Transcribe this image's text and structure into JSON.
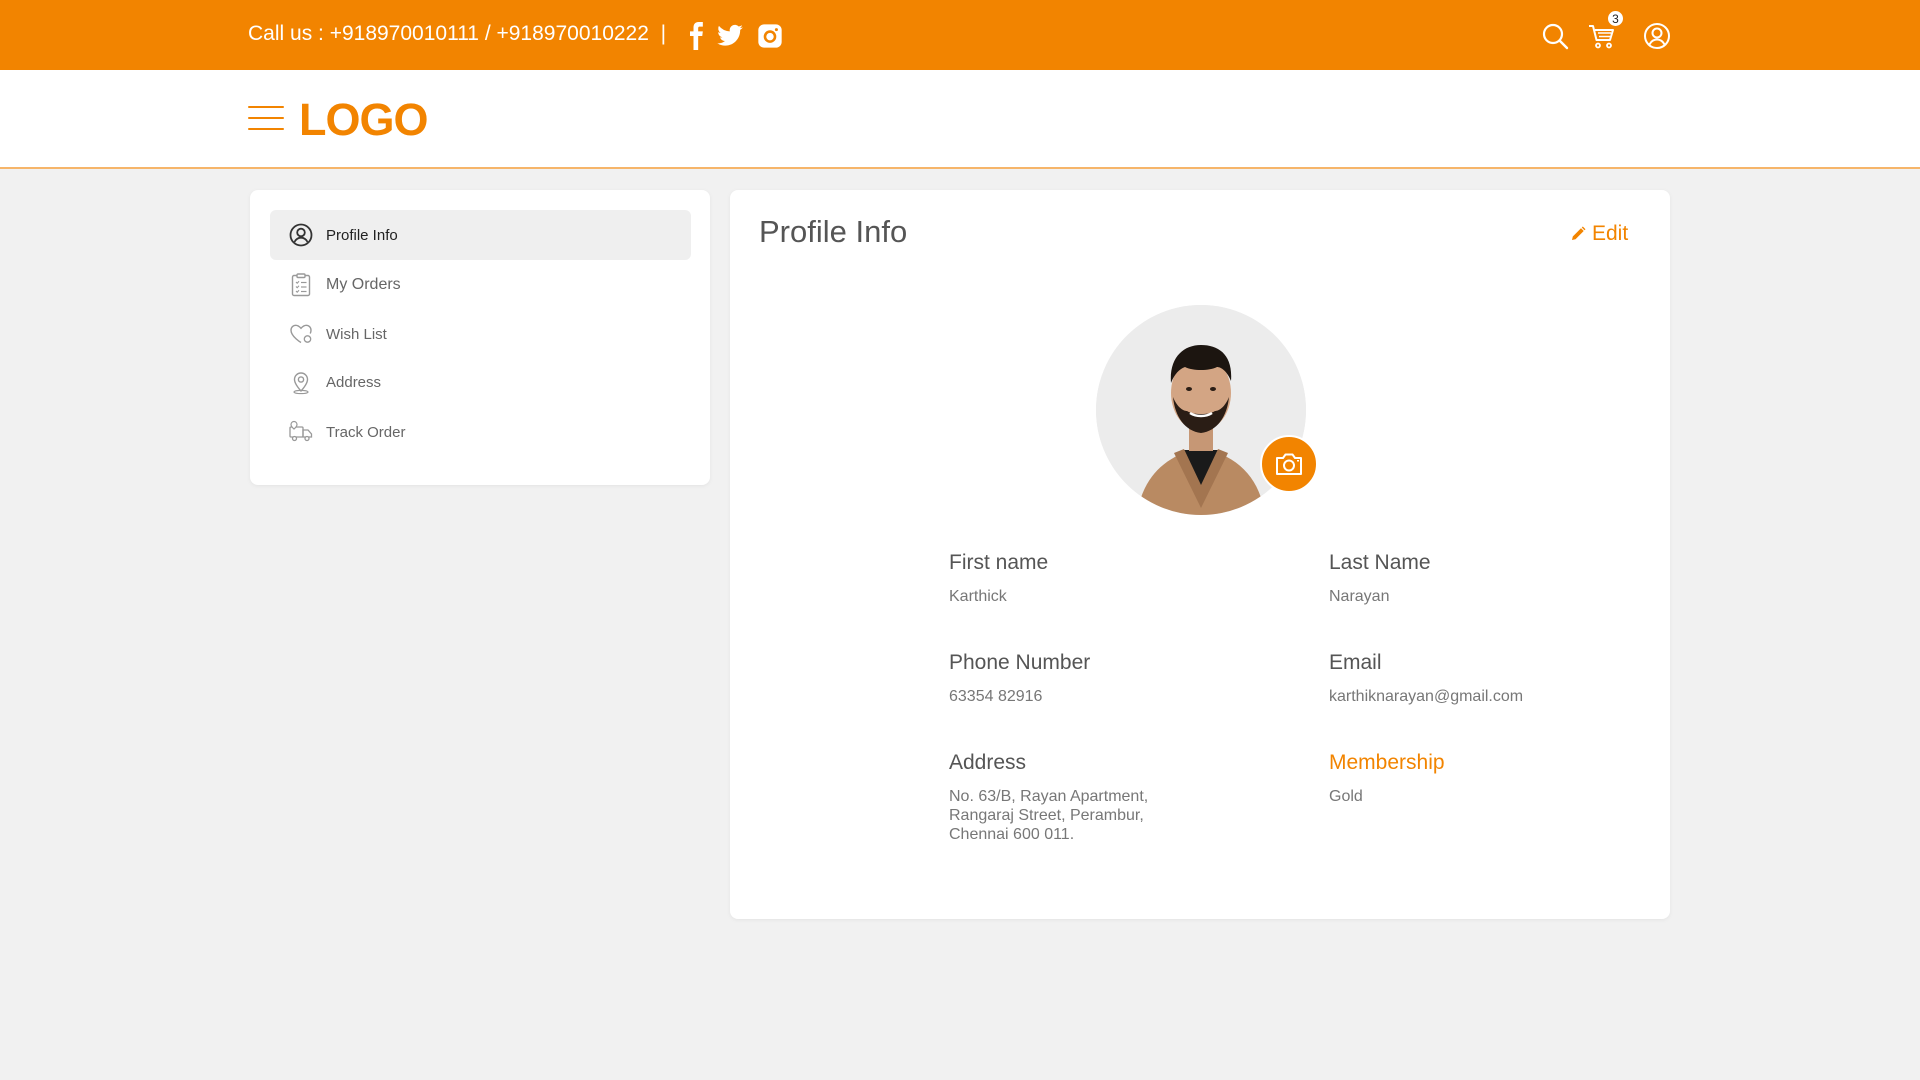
{
  "topbar": {
    "call_text": "Call us : +918970010111 / +918970010222  |",
    "social_icons": [
      "facebook-icon",
      "twitter-icon",
      "instagram-icon"
    ],
    "cart_count": "3",
    "bg_color": "#f28400"
  },
  "navbar": {
    "logo": "LOGO"
  },
  "sidebar": {
    "items": [
      {
        "label": "Profile Info",
        "icon": "user-circle-icon",
        "active": true
      },
      {
        "label": "My Orders",
        "icon": "clipboard-list-icon",
        "active": false
      },
      {
        "label": "Wish List",
        "icon": "heart-icon",
        "active": false
      },
      {
        "label": "Address",
        "icon": "location-pin-icon",
        "active": false
      },
      {
        "label": "Track Order",
        "icon": "truck-icon",
        "active": false
      }
    ]
  },
  "profile": {
    "title": "Profile Info",
    "edit_label": "Edit",
    "fields": {
      "first_name": {
        "label": "First name",
        "value": "Karthick"
      },
      "last_name": {
        "label": "Last Name",
        "value": "Narayan"
      },
      "phone": {
        "label": "Phone Number",
        "value": "63354 82916"
      },
      "email": {
        "label": "Email",
        "value": "karthiknarayan@gmail.com"
      },
      "address": {
        "label": "Address",
        "lines": [
          "No. 63/B, Rayan Apartment,",
          "Rangaraj Street, Perambur,",
          "Chennai 600 011."
        ]
      },
      "membership": {
        "label": "Membership",
        "value": "Gold"
      }
    }
  },
  "colors": {
    "accent": "#f28400",
    "background": "#f1f1f1"
  }
}
